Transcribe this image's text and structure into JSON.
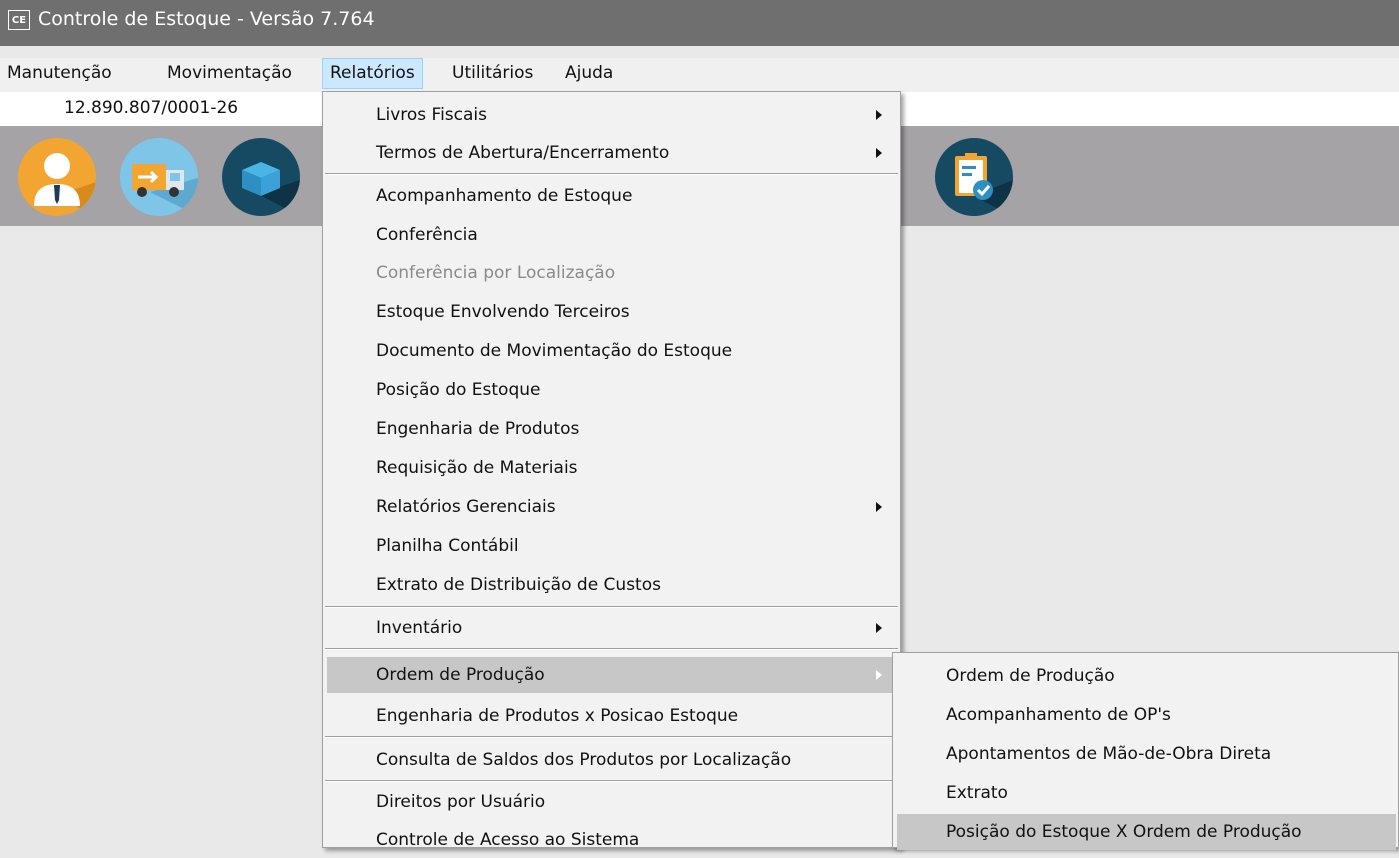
{
  "window": {
    "title": "Controle de Estoque - Versão 7.764",
    "icon_label": "CE"
  },
  "menubar": {
    "items": [
      {
        "label": "Manutenção"
      },
      {
        "label": "Movimentação"
      },
      {
        "label": "Relatórios"
      },
      {
        "label": "Utilitários"
      },
      {
        "label": "Ajuda"
      }
    ]
  },
  "infobar": {
    "cnpj": "12.890.807/0001-26"
  },
  "toolbar": {
    "icons": [
      "user-manager-icon",
      "delivery-truck-icon",
      "box-icon",
      "document-check-icon"
    ]
  },
  "relatorios_menu": {
    "items": [
      {
        "label": "Livros Fiscais"
      },
      {
        "label": "Termos de Abertura/Encerramento"
      },
      {
        "label": "Acompanhamento de Estoque"
      },
      {
        "label": "Conferência"
      },
      {
        "label": "Conferência por Localização"
      },
      {
        "label": "Estoque Envolvendo Terceiros"
      },
      {
        "label": "Documento de Movimentação do Estoque"
      },
      {
        "label": "Posição do Estoque"
      },
      {
        "label": "Engenharia de Produtos"
      },
      {
        "label": "Requisição de Materiais"
      },
      {
        "label": "Relatórios Gerenciais"
      },
      {
        "label": "Planilha Contábil"
      },
      {
        "label": "Extrato de Distribuição de Custos"
      },
      {
        "label": "Inventário"
      },
      {
        "label": "Ordem de Produção"
      },
      {
        "label": "Engenharia de Produtos x Posicao Estoque"
      },
      {
        "label": "Consulta de Saldos dos Produtos por Localização"
      },
      {
        "label": "Direitos por Usuário"
      },
      {
        "label": "Controle de Acesso ao Sistema"
      }
    ]
  },
  "ordem_producao_submenu": {
    "items": [
      {
        "label": "Ordem de Produção"
      },
      {
        "label": "Acompanhamento de OP's"
      },
      {
        "label": "Apontamentos de Mão-de-Obra Direta"
      },
      {
        "label": "Extrato"
      },
      {
        "label": "Posição do Estoque X Ordem de Produção"
      }
    ]
  },
  "colors": {
    "titlebar": "#6f6f6f",
    "menu_open": "#cce8ff",
    "menu_highlight": "#c7c7c7",
    "toolbar": "#a5a3a6",
    "disabled_text": "#8a8a8a"
  }
}
